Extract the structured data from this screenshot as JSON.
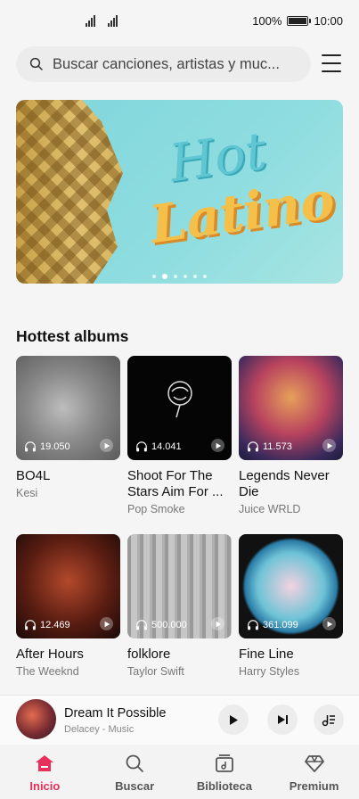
{
  "status_bar": {
    "battery_text": "100%",
    "time": "10:00"
  },
  "search": {
    "placeholder": "Buscar canciones, artistas y muc..."
  },
  "banner": {
    "line1": "Hot",
    "line2": "Latino",
    "active_slide": 2,
    "slide_count": 6
  },
  "section": {
    "title": "Hottest albums"
  },
  "albums": [
    {
      "title": "BO4L",
      "artist": "Kesi",
      "plays": "19.050"
    },
    {
      "title": "Shoot For The Stars Aim For ...",
      "artist": "Pop Smoke",
      "plays": "14.041"
    },
    {
      "title": "Legends Never Die",
      "artist": "Juice WRLD",
      "plays": "11.573"
    },
    {
      "title": "After Hours",
      "artist": "The Weeknd",
      "plays": "12.469"
    },
    {
      "title": "folklore",
      "artist": "Taylor Swift",
      "plays": "500.000"
    },
    {
      "title": "Fine Line",
      "artist": "Harry Styles",
      "plays": "361.099"
    }
  ],
  "player": {
    "title": "Dream It Possible",
    "artist": "Delacey - Music"
  },
  "nav": {
    "items": [
      {
        "label": "Inicio",
        "icon": "home-icon"
      },
      {
        "label": "Buscar",
        "icon": "search-icon"
      },
      {
        "label": "Biblioteca",
        "icon": "library-icon"
      },
      {
        "label": "Premium",
        "icon": "diamond-icon"
      }
    ]
  },
  "colors": {
    "accent": "#e8315a",
    "banner_bg": "#8fdde0"
  }
}
